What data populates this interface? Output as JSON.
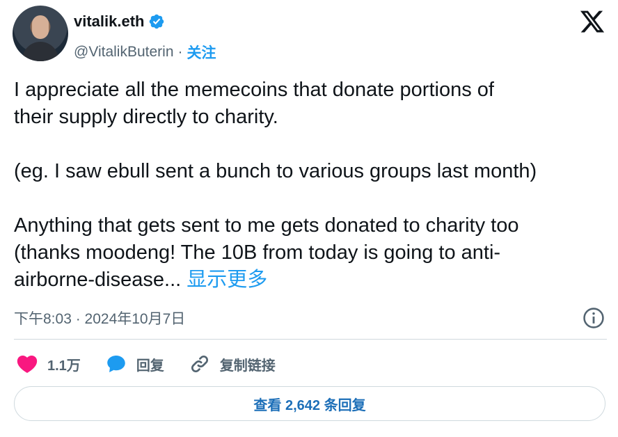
{
  "author": {
    "name": "vitalik.eth",
    "handle": "@VitalikButerin",
    "separator": "·",
    "follow_label": "关注"
  },
  "tweet": {
    "text": "I appreciate all the memecoins that donate portions of\ntheir supply directly to charity.\n\n(eg. I saw ebull sent a bunch to various groups last month)\n\nAnything that gets sent to me gets donated to charity too\n(thanks moodeng! The 10B from today is going to anti-\nairborne-disease... ",
    "show_more": "显示更多",
    "timestamp": "下午8:03 · 2024年10月7日"
  },
  "actions": {
    "likes": "1.1万",
    "reply_label": "回复",
    "copy_link_label": "复制链接"
  },
  "replies_button": "查看 2,642 条回复",
  "colors": {
    "accent": "#1d9bf0",
    "like": "#f91880",
    "text": "#0f1419",
    "muted": "#536471"
  }
}
